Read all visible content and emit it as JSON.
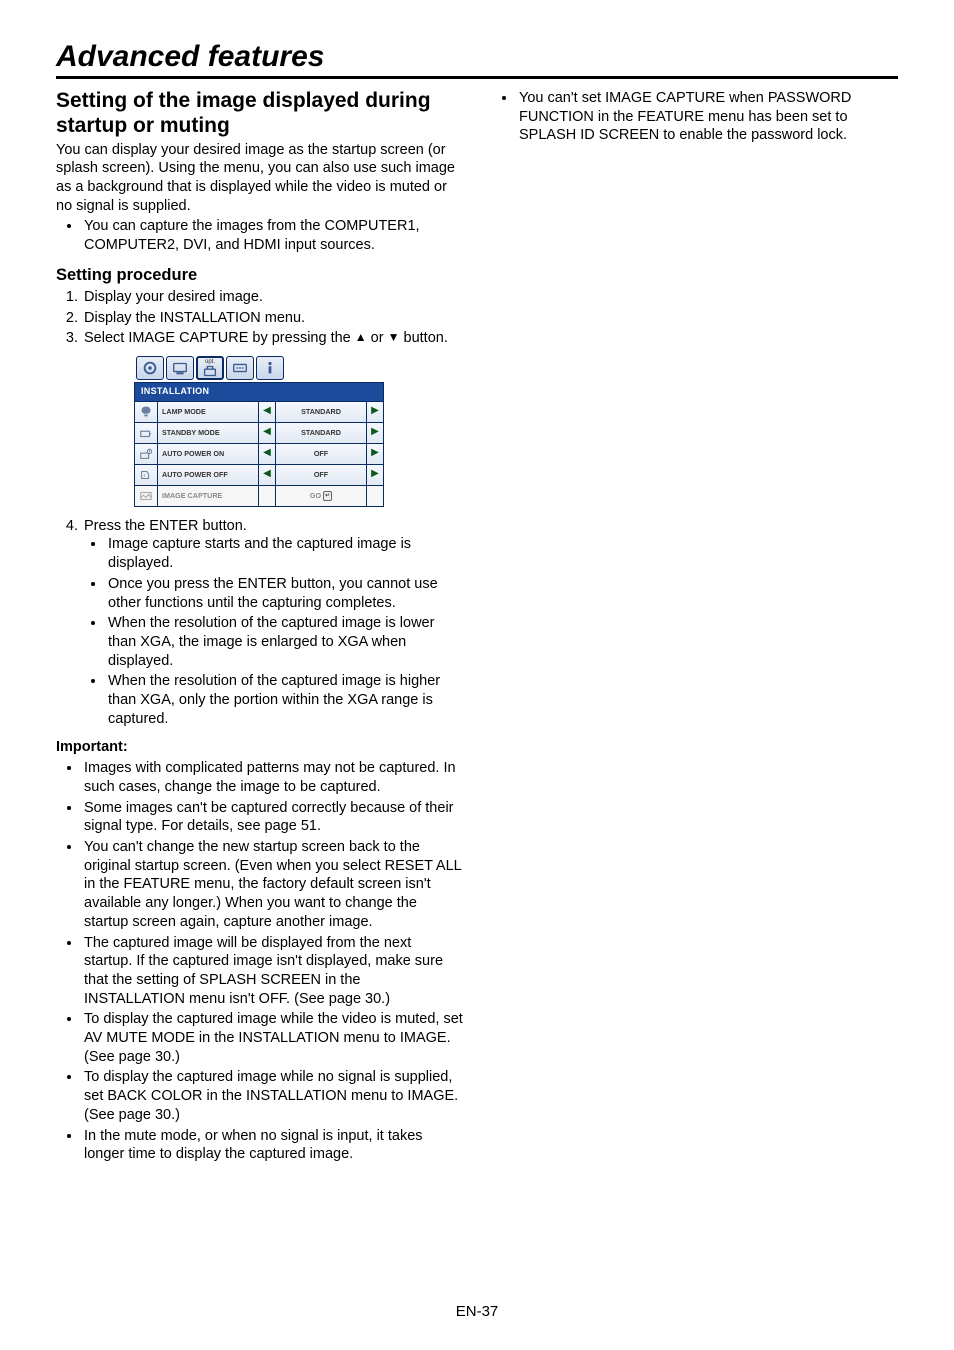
{
  "page": {
    "title": "Advanced features",
    "footer": "EN-37"
  },
  "left": {
    "heading": "Setting of the image displayed during startup or muting",
    "intro": "You can display your desired image as the startup screen (or splash screen). Using the menu, you can also use such image as a background that is displayed while the video is muted or no signal is supplied.",
    "intro_bullet": "You can capture the images from the COMPUTER1, COMPUTER2, DVI, and HDMI input sources.",
    "proc_heading": "Setting procedure",
    "step1": "Display your desired image.",
    "step2": "Display the INSTALLATION menu.",
    "step3_a": "Select IMAGE CAPTURE by pressing the ",
    "step3_b": " or ",
    "step3_c": " button.",
    "step4": "Press the ENTER button.",
    "step4_sub": [
      "Image capture starts and the captured image is displayed.",
      "Once you press the ENTER button, you cannot use other functions until the capturing completes.",
      "When the resolution of the captured image is lower than XGA, the image is enlarged to XGA when displayed.",
      "When the resolution of the captured image is higher than XGA, only the portion within the XGA range is captured."
    ],
    "important_label": "Important:",
    "important": [
      "Images with complicated patterns may not be captured. In such cases, change the image to be captured.",
      "Some images can't be captured correctly because of their signal type. For details, see page 51.",
      "You can't change the new startup screen back to the original startup screen. (Even when you select RESET ALL in the FEATURE menu, the factory default screen isn't available any longer.) When you want to change the startup screen again, capture another image.",
      "The captured image will be displayed from the next startup. If the captured image isn't displayed, make sure that the setting of SPLASH SCREEN in the INSTALLATION menu isn't OFF. (See page 30.)",
      "To display the captured image while the video is muted, set AV MUTE MODE in the INSTALLATION menu to IMAGE. (See page 30.)",
      "To display the captured image while no signal is supplied, set BACK COLOR in the INSTALLATION menu to IMAGE. (See page 30.)",
      "In the mute mode, or when no signal is input, it takes longer time to display the captured image."
    ]
  },
  "right": {
    "bullet": "You can't set IMAGE CAPTURE when PASSWORD FUNCTION in the FEATURE menu has been set to SPLASH ID SCREEN to enable the password lock."
  },
  "menu": {
    "header": "INSTALLATION",
    "opt_label": "opt.",
    "rows": [
      {
        "label": "LAMP MODE",
        "value": "STANDARD",
        "arrows": true
      },
      {
        "label": "STANDBY MODE",
        "value": "STANDARD",
        "arrows": true
      },
      {
        "label": "AUTO POWER ON",
        "value": "OFF",
        "arrows": true
      },
      {
        "label": "AUTO POWER OFF",
        "value": "OFF",
        "arrows": true
      },
      {
        "label": "IMAGE CAPTURE",
        "value": "GO",
        "arrows": false,
        "muted": true,
        "enter": true
      }
    ]
  }
}
